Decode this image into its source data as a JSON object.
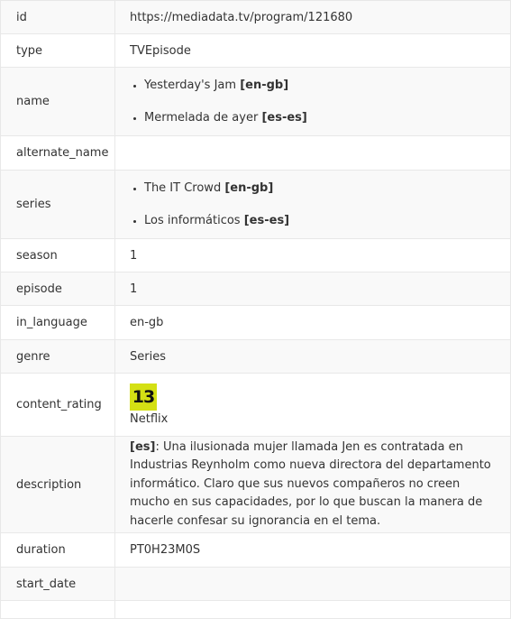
{
  "rows": {
    "id": {
      "key": "id",
      "value": "https://mediadata.tv/program/121680"
    },
    "type": {
      "key": "type",
      "value": "TVEpisode"
    },
    "name": {
      "key": "name",
      "items": [
        {
          "text": "Yesterday's Jam",
          "lang": "[en-gb]"
        },
        {
          "text": "Mermelada de ayer",
          "lang": "[es-es]"
        }
      ]
    },
    "alternate_name": {
      "key": "alternate_name",
      "value": ""
    },
    "series": {
      "key": "series",
      "items": [
        {
          "text": "The IT Crowd",
          "lang": "[en-gb]"
        },
        {
          "text": "Los informáticos",
          "lang": "[es-es]"
        }
      ]
    },
    "season": {
      "key": "season",
      "value": "1"
    },
    "episode": {
      "key": "episode",
      "value": "1"
    },
    "in_language": {
      "key": "in_language",
      "value": "en-gb"
    },
    "genre": {
      "key": "genre",
      "value": "Series"
    },
    "content_rating": {
      "key": "content_rating",
      "badge": "13",
      "badge_color": "#d4e014",
      "source": "Netflix"
    },
    "description": {
      "key": "description",
      "lang": "[es]",
      "text": ": Una ilusionada mujer llamada Jen es contratada en Industrias Reynholm como nueva directora del departamento informático. Claro que sus nuevos compañeros no creen mucho en sus capacidades, por lo que buscan la manera de hacerle confesar su ignorancia en el tema."
    },
    "duration": {
      "key": "duration",
      "value": "PT0H23M0S"
    },
    "start_date": {
      "key": "start_date",
      "value": ""
    }
  }
}
